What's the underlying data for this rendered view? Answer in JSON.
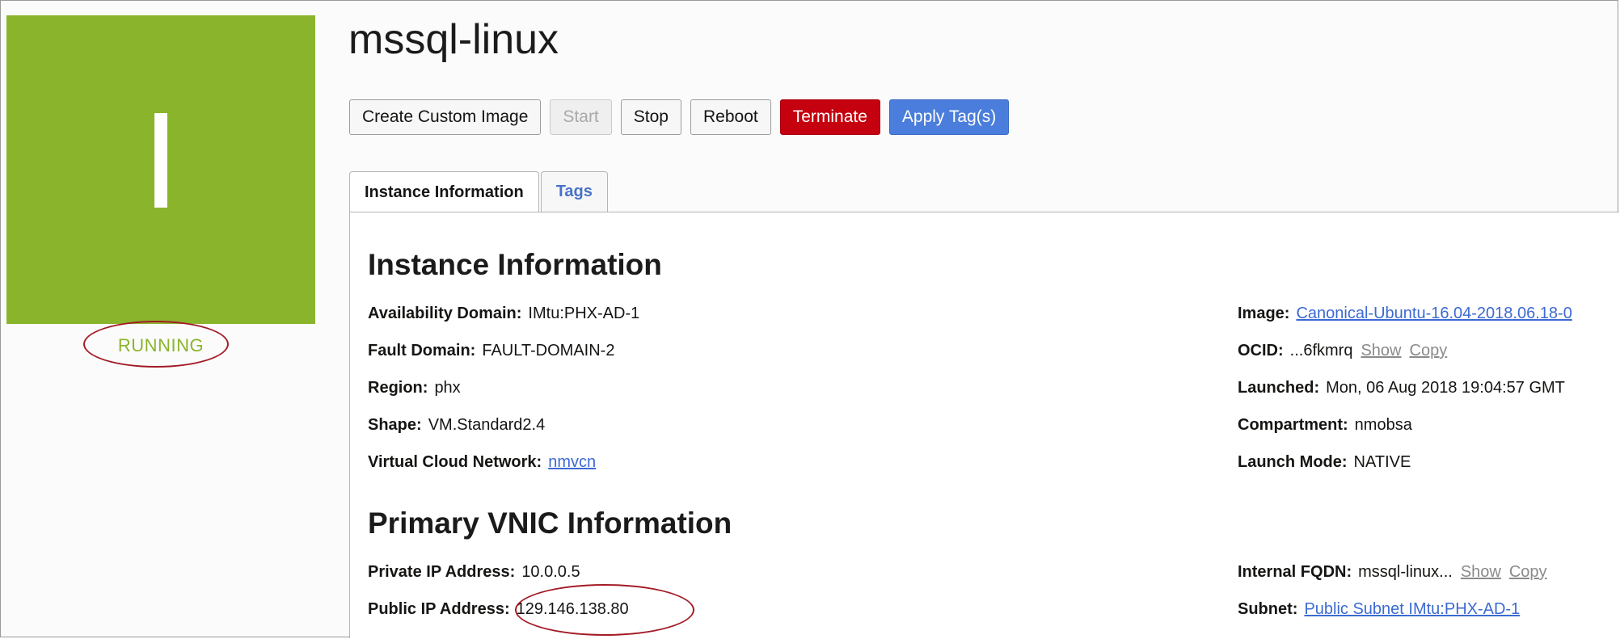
{
  "status": {
    "letter": "I",
    "state": "RUNNING"
  },
  "title": "mssql-linux",
  "toolbar": {
    "create_custom_image": "Create Custom Image",
    "start": "Start",
    "stop": "Stop",
    "reboot": "Reboot",
    "terminate": "Terminate",
    "apply_tags": "Apply Tag(s)"
  },
  "tabs": [
    {
      "label": "Instance Information",
      "active": true
    },
    {
      "label": "Tags",
      "active": false
    }
  ],
  "instance_info": {
    "heading": "Instance Information",
    "left": [
      {
        "label": "Availability Domain:",
        "value": "IMtu:PHX-AD-1"
      },
      {
        "label": "Fault Domain:",
        "value": "FAULT-DOMAIN-2"
      },
      {
        "label": "Region:",
        "value": "phx"
      },
      {
        "label": "Shape:",
        "value": "VM.Standard2.4"
      },
      {
        "label": "Virtual Cloud Network:",
        "value": "nmvcn"
      }
    ],
    "right": [
      {
        "label": "Image:",
        "value": "Canonical-Ubuntu-16.04-2018.06.18-0"
      },
      {
        "label": "OCID:",
        "value": "...6fkmrq",
        "show": "Show",
        "copy": "Copy"
      },
      {
        "label": "Launched:",
        "value": "Mon, 06 Aug 2018 19:04:57 GMT"
      },
      {
        "label": "Compartment:",
        "value": "nmobsa"
      },
      {
        "label": "Launch Mode:",
        "value": "NATIVE"
      }
    ]
  },
  "vnic_info": {
    "heading": "Primary VNIC Information",
    "left": [
      {
        "label": "Private IP Address:",
        "value": "10.0.0.5"
      },
      {
        "label": "Public IP Address:",
        "value": "129.146.138.80"
      }
    ],
    "right": [
      {
        "label": "Internal FQDN:",
        "value": "mssql-linux...",
        "show": "Show",
        "copy": "Copy"
      },
      {
        "label": "Subnet:",
        "value": "Public Subnet IMtu:PHX-AD-1"
      }
    ]
  },
  "colors": {
    "status_green": "#8bb42d",
    "terminate_red": "#c5000f",
    "primary_blue": "#4b7edc",
    "link_blue": "#3c6ad2",
    "annotation_circle": "#a31b26"
  }
}
